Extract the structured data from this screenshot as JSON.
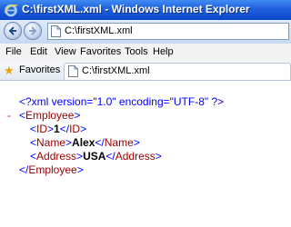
{
  "window": {
    "title": "C:\\firstXML.xml - Windows Internet Explorer"
  },
  "address_bar": {
    "url": "C:\\firstXML.xml"
  },
  "menu": {
    "items": [
      "File",
      "Edit",
      "View",
      "Favorites",
      "Tools",
      "Help"
    ]
  },
  "favorites_bar": {
    "favorites_label": "Favorites",
    "tab_title": "C:\\firstXML.xml"
  },
  "icons": {
    "browser": "ie-logo-icon",
    "back": "back-arrow-icon",
    "forward": "forward-arrow-icon",
    "page": "page-icon",
    "favorites": "star-icon"
  },
  "xml": {
    "declaration": "<?xml version=\"1.0\" encoding=\"UTF-8\" ?>",
    "collapse_marker": "-",
    "root_open": "Employee",
    "root_close": "Employee",
    "children": [
      {
        "tag": "ID",
        "value": "1"
      },
      {
        "tag": "Name",
        "value": "Alex"
      },
      {
        "tag": "Address",
        "value": "USA"
      }
    ]
  },
  "colors": {
    "title_bar": "#1f5fdc",
    "xml_bracket": "#0000ff",
    "xml_tag": "#990000",
    "collapse_marker": "#ff0000"
  }
}
